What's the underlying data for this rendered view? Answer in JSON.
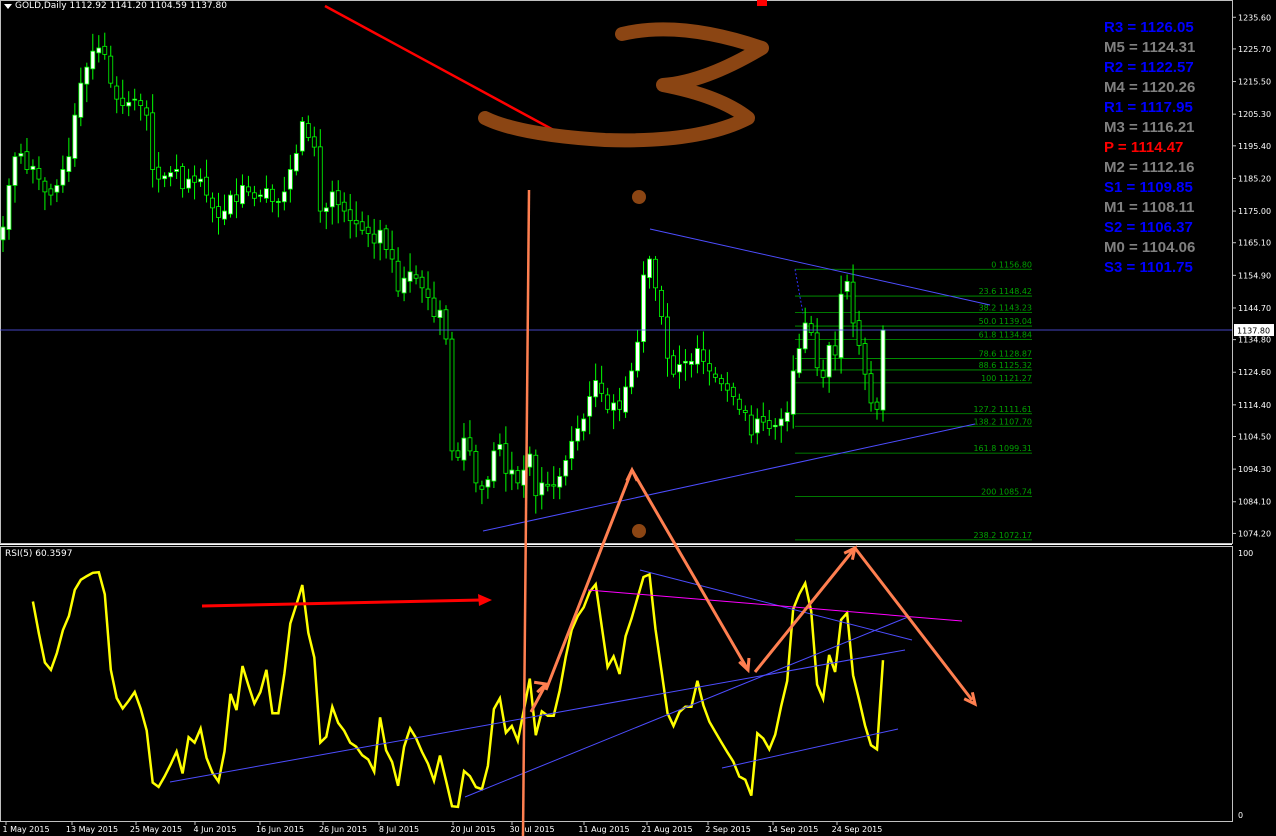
{
  "header": {
    "symbol_label": "GOLD,Daily",
    "ohlc": "1112.92 1141.20 1104.59 1137.80"
  },
  "rsi": {
    "label": "RSI(5) 60.3597",
    "top_level": "100",
    "bottom_level": "0"
  },
  "pivots": [
    {
      "label": "R3 = 1126.05",
      "color": "#0000ff"
    },
    {
      "label": "M5 = 1124.31",
      "color": "#808080"
    },
    {
      "label": "R2 = 1122.57",
      "color": "#0000ff"
    },
    {
      "label": "M4 = 1120.26",
      "color": "#808080"
    },
    {
      "label": "R1 = 1117.95",
      "color": "#0000ff"
    },
    {
      "label": "M3 = 1116.21",
      "color": "#808080"
    },
    {
      "label": "P   = 1114.47",
      "color": "#ff0000"
    },
    {
      "label": "M2 = 1112.16",
      "color": "#808080"
    },
    {
      "label": "S1 = 1109.85",
      "color": "#0000ff"
    },
    {
      "label": "M1 = 1108.11",
      "color": "#808080"
    },
    {
      "label": "S2 = 1106.37",
      "color": "#0000ff"
    },
    {
      "label": "M0 = 1104.06",
      "color": "#808080"
    },
    {
      "label": "S3 = 1101.75",
      "color": "#0000ff"
    }
  ],
  "current_price_label": "1137.80",
  "colors": {
    "background": "#000000",
    "bull_candle": "#ffffff",
    "bear_candle": "#000000",
    "wick": "#00ff00",
    "rsi_line": "#ffff00",
    "fib": "#00a000",
    "trendline": "#4d4dff",
    "annotation_orange": "#ff7f50",
    "annotation_red": "#ff0000",
    "annotation_brown": "#8b4513",
    "axis_text": "#ffffff",
    "magenta": "#ff00ff"
  },
  "chart_data": {
    "type": "candlestick",
    "ylim": [
      1071.2,
      1238.5
    ],
    "y_ticks": [
      "1235.60",
      "1225.70",
      "1215.50",
      "1205.30",
      "1195.40",
      "1185.20",
      "1175.00",
      "1165.10",
      "1154.90",
      "1144.70",
      "1134.80",
      "1124.60",
      "1114.40",
      "1104.50",
      "1094.30",
      "1084.10",
      "1074.20"
    ],
    "x_ticks": [
      "1 May 2015",
      "13 May 2015",
      "25 May 2015",
      "4 Jun 2015",
      "16 Jun 2015",
      "26 Jun 2015",
      "8 Jul 2015",
      "20 Jul 2015",
      "30 Jul 2015",
      "11 Aug 2015",
      "21 Aug 2015",
      "2 Sep 2015",
      "14 Sep 2015",
      "24 Sep 2015"
    ],
    "close_level": 1137.8,
    "fib_levels": [
      {
        "label": "0 1156.80",
        "value": 1156.8
      },
      {
        "label": "23.6 1148.42",
        "value": 1148.42
      },
      {
        "label": "38.2 1143.23",
        "value": 1143.23
      },
      {
        "label": "50.0 1139.04",
        "value": 1139.04
      },
      {
        "label": "61.8 1134.84",
        "value": 1134.84
      },
      {
        "label": "78.6 1128.87",
        "value": 1128.87
      },
      {
        "label": "88.6 1125.32",
        "value": 1125.32
      },
      {
        "label": "100 1121.27",
        "value": 1121.27
      },
      {
        "label": "127.2 1111.61",
        "value": 1111.61
      },
      {
        "label": "138.2 1107.70",
        "value": 1107.7
      },
      {
        "label": "161.8 1099.31",
        "value": 1099.31
      },
      {
        "label": "200 1085.74",
        "value": 1085.74
      },
      {
        "label": "238.2 1072.17",
        "value": 1072.17
      }
    ],
    "closes": [
      1170,
      1183,
      1192,
      1193,
      1188,
      1189,
      1185,
      1181,
      1180,
      1183,
      1188,
      1192,
      1205,
      1215,
      1220,
      1225,
      1226,
      1224,
      1215,
      1210,
      1208,
      1209,
      1210,
      1208,
      1205,
      1188,
      1185,
      1186,
      1187,
      1188,
      1182,
      1185,
      1184,
      1185,
      1180,
      1176,
      1173,
      1175,
      1180,
      1178,
      1183,
      1181,
      1179,
      1180,
      1182,
      1178,
      1178,
      1181,
      1188,
      1193,
      1203,
      1198,
      1195,
      1175,
      1176,
      1181,
      1177,
      1175,
      1172,
      1171,
      1169,
      1168,
      1165,
      1169,
      1163,
      1160,
      1150,
      1154,
      1156,
      1154,
      1151,
      1148,
      1142,
      1144,
      1135,
      1100,
      1098,
      1104,
      1100,
      1090,
      1088,
      1091,
      1100,
      1102,
      1093,
      1094,
      1090,
      1094,
      1099,
      1086,
      1090,
      1089,
      1089,
      1092,
      1097,
      1103,
      1107,
      1110,
      1117,
      1122,
      1118,
      1113,
      1115,
      1113,
      1120,
      1125,
      1134,
      1155,
      1160,
      1151,
      1142,
      1129,
      1124,
      1127,
      1128,
      1128,
      1132,
      1128,
      1125,
      1123,
      1121,
      1119,
      1117,
      1113,
      1112,
      1105,
      1110,
      1109,
      1107,
      1108,
      1110,
      1112,
      1125,
      1132,
      1140,
      1137,
      1126,
      1123,
      1133,
      1130,
      1149,
      1153,
      1140,
      1133,
      1124,
      1115,
      1113,
      1137.8
    ],
    "rsi_ylim": [
      0,
      100
    ]
  }
}
